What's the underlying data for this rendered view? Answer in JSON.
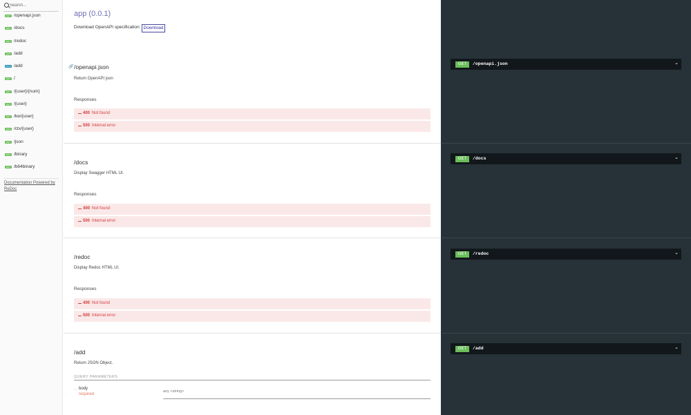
{
  "sidebar": {
    "search_placeholder": "Search...",
    "items": [
      {
        "method": "GET",
        "label": "/openapi.json",
        "color": "#6bbd5b"
      },
      {
        "method": "GET",
        "label": "/docs",
        "color": "#6bbd5b"
      },
      {
        "method": "GET",
        "label": "/redoc",
        "color": "#6bbd5b"
      },
      {
        "method": "GET",
        "label": "/add",
        "color": "#6bbd5b"
      },
      {
        "method": "POST",
        "label": "/add",
        "color": "#248fb2"
      },
      {
        "method": "GET",
        "label": "/",
        "color": "#6bbd5b"
      },
      {
        "method": "GET",
        "label": "/{user}/{num}",
        "color": "#6bbd5b"
      },
      {
        "method": "GET",
        "label": "/{user}",
        "color": "#6bbd5b"
      },
      {
        "method": "GET",
        "label": "/kw/{user}",
        "color": "#6bbd5b"
      },
      {
        "method": "GET",
        "label": "/ctx/{user}",
        "color": "#6bbd5b"
      },
      {
        "method": "GET",
        "label": "/json",
        "color": "#6bbd5b"
      },
      {
        "method": "GET",
        "label": "/binary",
        "color": "#6bbd5b"
      },
      {
        "method": "GET",
        "label": "/b64binary",
        "color": "#6bbd5b"
      }
    ],
    "powered_by": "Documentation Powered by ReDoc"
  },
  "api": {
    "title": "app (0.0.1)",
    "download_text": "Download OpenAPI specification:",
    "download_button": "Download"
  },
  "operations": [
    {
      "path": "/openapi.json",
      "description": "Return OpenAPI json",
      "responses_label": "Responses",
      "responses": [
        {
          "code": "400",
          "message": "Not found"
        },
        {
          "code": "500",
          "message": "Internal error"
        }
      ],
      "method": "GET",
      "panel_path": "/openapi.json"
    },
    {
      "path": "/docs",
      "description": "Display Swagger HTML UI.",
      "responses_label": "Responses",
      "responses": [
        {
          "code": "400",
          "message": "Not found"
        },
        {
          "code": "500",
          "message": "Internal error"
        }
      ],
      "method": "GET",
      "panel_path": "/docs"
    },
    {
      "path": "/redoc",
      "description": "Display Redoc HTML UI.",
      "responses_label": "Responses",
      "responses": [
        {
          "code": "400",
          "message": "Not found"
        },
        {
          "code": "500",
          "message": "Internal error"
        }
      ],
      "method": "GET",
      "panel_path": "/redoc"
    },
    {
      "path": "/add",
      "description": "Return JSON Object.",
      "query_params_label": "QUERY PARAMETERS",
      "params": [
        {
          "name": "body",
          "required": "required",
          "type": "any <string>"
        }
      ],
      "method": "GET",
      "panel_path": "/add"
    }
  ],
  "colors": {
    "accent": "#32329f",
    "get_badge": "#6bbd5b",
    "post_badge": "#248fb2",
    "error": "#d63a3a",
    "error_bg": "#fae8e8",
    "right_panel": "#263238",
    "op_bar": "#11171a"
  }
}
